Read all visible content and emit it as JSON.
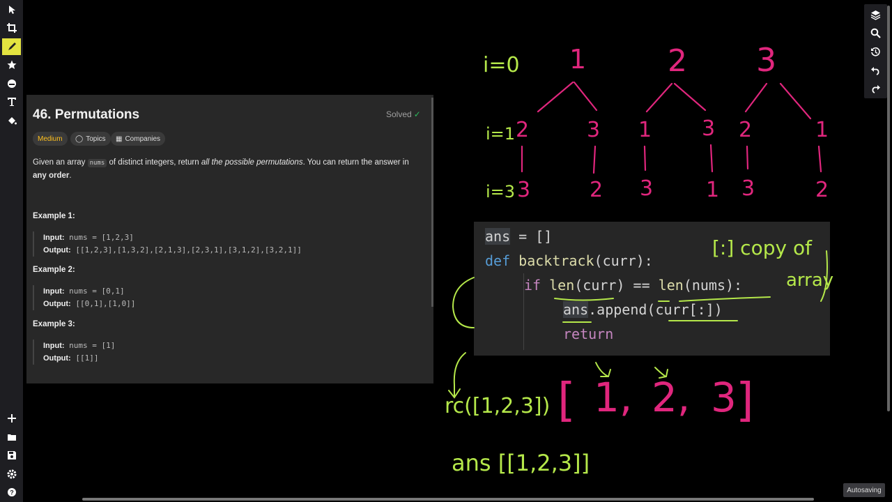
{
  "left_toolbar": {
    "tools": [
      "pointer-icon",
      "crop-icon",
      "pen-icon",
      "star-icon",
      "emoji-icon",
      "text-icon",
      "fill-icon"
    ],
    "bottom_tools": [
      "plus-icon",
      "folder-icon",
      "save-icon",
      "settings-icon",
      "help-icon"
    ]
  },
  "right_toolbar": {
    "tools": [
      "layers-icon",
      "zoom-icon",
      "history-icon",
      "undo-icon",
      "redo-icon"
    ]
  },
  "status": {
    "autosave": "Autosaving"
  },
  "problem": {
    "title": "46. Permutations",
    "solved": "Solved",
    "tags": {
      "difficulty": "Medium",
      "topics": "Topics",
      "companies": "Companies"
    },
    "desc_pre": "Given an array ",
    "desc_code": "nums",
    "desc_mid": " of distinct integers, return ",
    "desc_em": "all the possible permutations",
    "desc_post": ". You can return the answer in ",
    "desc_bold": "any order",
    "desc_end": ".",
    "examples": [
      {
        "title": "Example 1:",
        "input_label": "Input:",
        "input": " nums = [1,2,3]",
        "output_label": "Output:",
        "output": " [[1,2,3],[1,3,2],[2,1,3],[2,3,1],[3,1,2],[3,2,1]]"
      },
      {
        "title": "Example 2:",
        "input_label": "Input:",
        "input": " nums = [0,1]",
        "output_label": "Output:",
        "output": " [[0,1],[1,0]]"
      },
      {
        "title": "Example 3:",
        "input_label": "Input:",
        "input": " nums = [1]",
        "output_label": "Output:",
        "output": " [[1]]"
      }
    ]
  },
  "code": {
    "l1_a": "ans",
    "l1_b": " = []",
    "l2_kw": "def",
    "l2_fn": " backtrack",
    "l2_rest": "(curr):",
    "l3_kw": "if",
    "l3_fn1": " len",
    "l3_mid": "(curr) == ",
    "l3_fn2": "len",
    "l3_rest": "(nums):",
    "l4_a": "ans",
    "l4_b": ".append(curr[:])",
    "l5": "return"
  },
  "annotations": {
    "i0": "i=0",
    "i1": "i=1",
    "i3": "i=3",
    "level0": [
      "1",
      "2",
      "3"
    ],
    "level1": [
      "2",
      "3",
      "1",
      "3",
      "2",
      "1"
    ],
    "level2": [
      "3",
      "2",
      "3",
      "1",
      "3",
      "2"
    ],
    "note1": "[:] copy of",
    "note2": "array",
    "call": "rc([1,2,3])",
    "arr_open": "[",
    "arr_1": "1,",
    "arr_2": "2,",
    "arr_3": "3",
    "arr_close": "]",
    "ans": "ans [[1,2,3]]"
  },
  "colors": {
    "pink": "#e0267d",
    "green": "#b5e84a",
    "accent": "#ffc01e"
  }
}
